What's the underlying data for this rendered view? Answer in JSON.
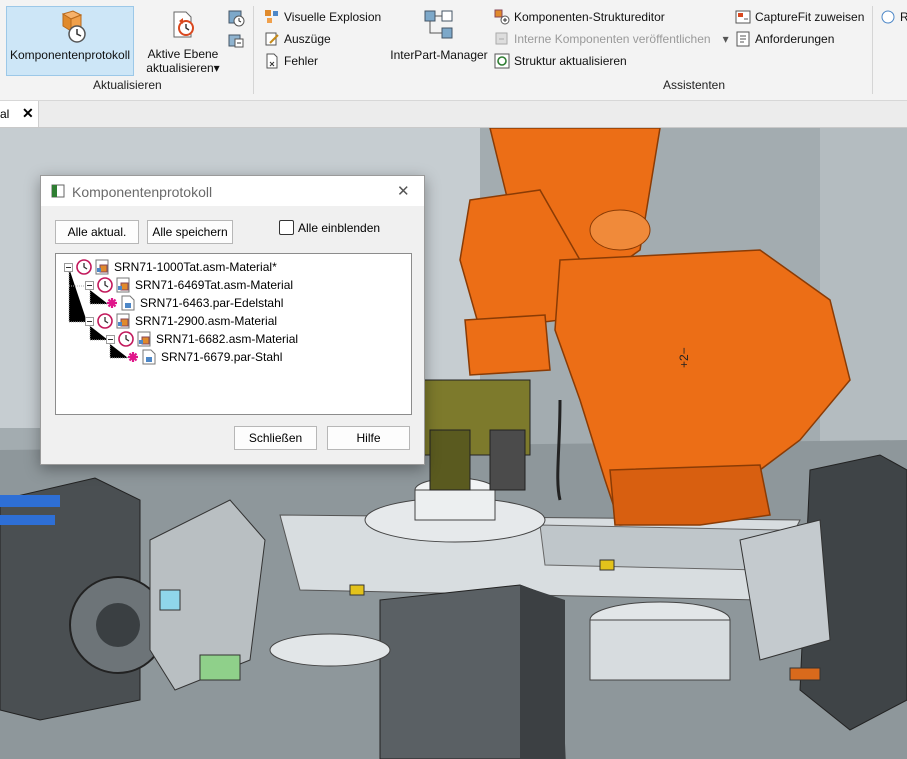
{
  "ribbon": {
    "aktualisieren": {
      "group_label": "Aktualisieren",
      "komponentenprotokoll": "Komponentenprotokoll",
      "aktive_ebene_line1": "Aktive Ebene",
      "aktive_ebene_line2": "aktualisieren",
      "dropdown_glyph": "▾"
    },
    "assistenten": {
      "group_label": "Assistenten",
      "visuelle_explosion": "Visuelle Explosion",
      "auszuege": "Auszüge",
      "fehler": "Fehler",
      "interpart_manager": "InterPart-Manager",
      "strukturditor": "Komponenten-Struktureditor",
      "interne_veroeffentlichen": "Interne Komponenten veröffentlichen",
      "struktur_aktualisieren": "Struktur aktualisieren",
      "capturefit": "CaptureFit zuweisen",
      "anforderungen": "Anforderungen",
      "cut_label": "R"
    }
  },
  "tabbar": {
    "tab_fragment": "al",
    "close_glyph": "✕"
  },
  "dialog": {
    "title": "Komponentenprotokoll",
    "close_glyph": "✕",
    "alle_aktual": "Alle aktual.",
    "alle_speichern": "Alle speichern",
    "alle_einblenden": "Alle einblenden",
    "alle_einblenden_checked": false,
    "schliessen": "Schließen",
    "hilfe": "Hilfe",
    "tree": [
      {
        "label": "SRN71-1000Tat.asm-Material*",
        "kind": "asm",
        "depth": 0
      },
      {
        "label": "SRN71-6469Tat.asm-Material",
        "kind": "asm",
        "depth": 1
      },
      {
        "label": "SRN71-6463.par-Edelstahl",
        "kind": "par",
        "depth": 2
      },
      {
        "label": "SRN71-2900.asm-Material",
        "kind": "asm",
        "depth": 1
      },
      {
        "label": "SRN71-6682.asm-Material",
        "kind": "asm",
        "depth": 2
      },
      {
        "label": "SRN71-6679.par-Stahl",
        "kind": "par",
        "depth": 3
      }
    ]
  },
  "viewport": {
    "robot_marking": "+2−"
  },
  "colors": {
    "selected_bg": "#cde6f7",
    "robot_orange": "#ec6e16",
    "part_changed_marker": "#e0168a"
  }
}
